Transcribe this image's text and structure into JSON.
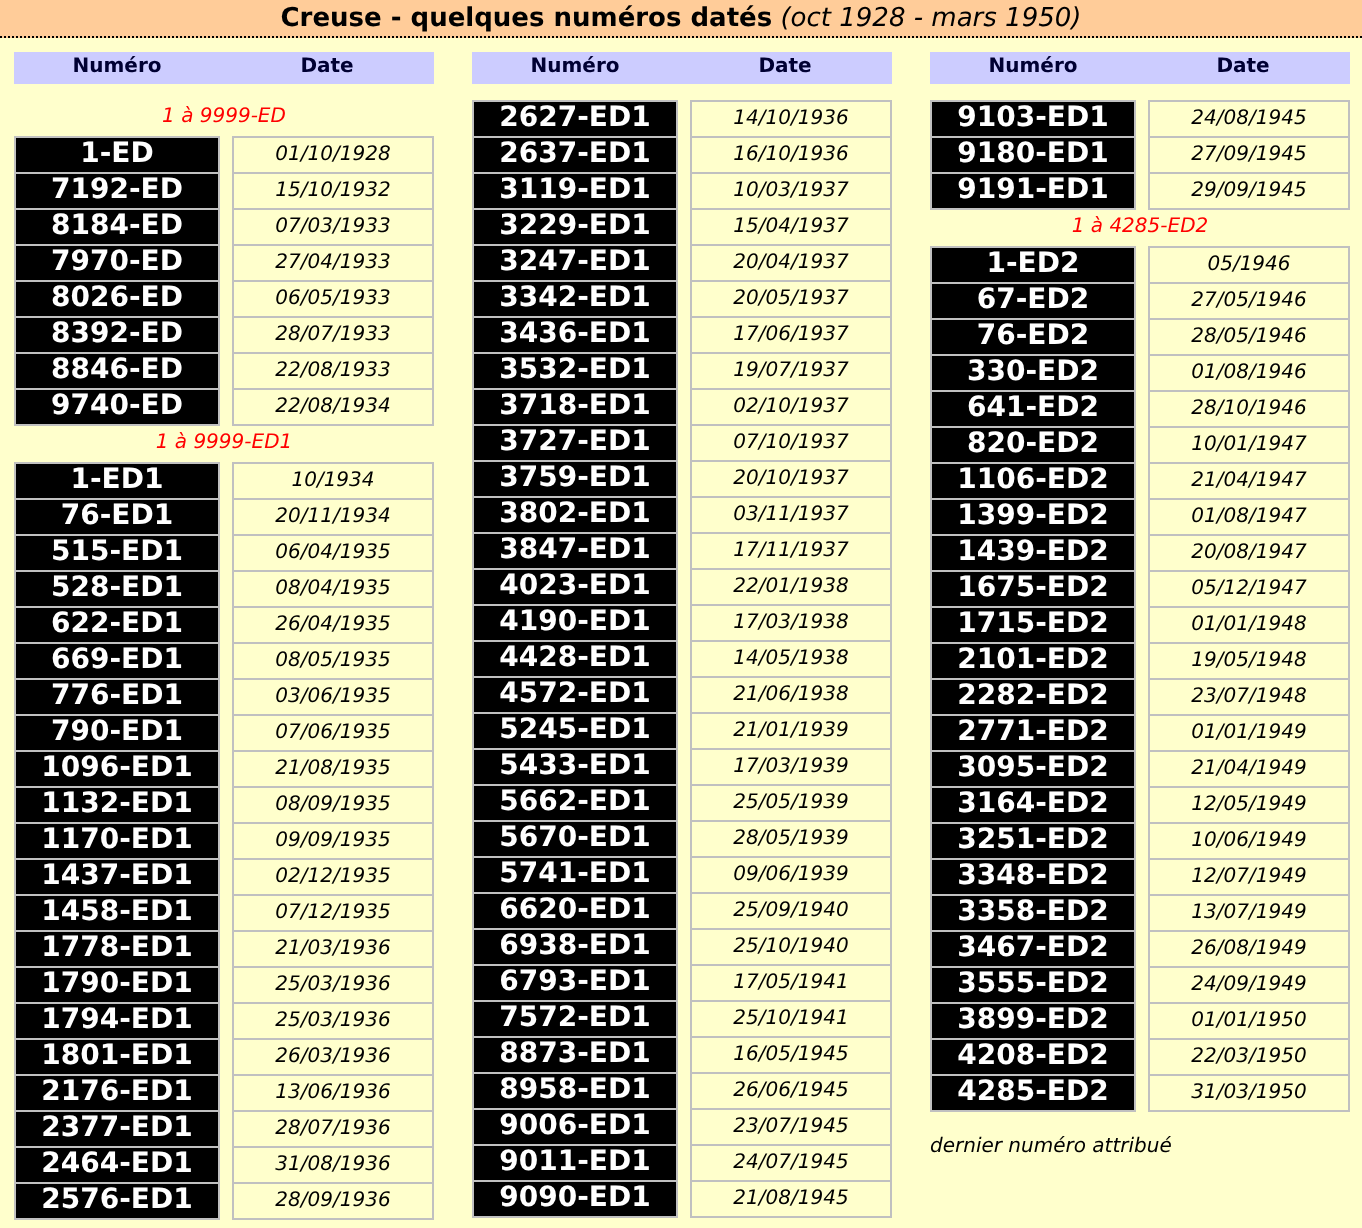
{
  "title": "**Creuse - quelques numéros datés** *(oct 1928 - mars 1950)*",
  "columns": [
    {
      "headers": [
        "Numéro",
        "Date"
      ],
      "blocks": [
        {
          "kind": "range",
          "text": "1 à 9999-ED"
        },
        {
          "kind": "group",
          "rows": [
            {
              "plate": "1-ED",
              "date": "01/10/1928"
            },
            {
              "plate": "7192-ED",
              "date": "15/10/1932"
            },
            {
              "plate": "8184-ED",
              "date": "07/03/1933"
            },
            {
              "plate": "7970-ED",
              "date": "27/04/1933"
            },
            {
              "plate": "8026-ED",
              "date": "06/05/1933"
            },
            {
              "plate": "8392-ED",
              "date": "28/07/1933"
            },
            {
              "plate": "8846-ED",
              "date": "22/08/1933"
            },
            {
              "plate": "9740-ED",
              "date": "22/08/1934"
            }
          ]
        },
        {
          "kind": "range",
          "text": "1 à 9999-ED1"
        },
        {
          "kind": "group",
          "rows": [
            {
              "plate": "1-ED1",
              "date": "10/1934"
            },
            {
              "plate": "76-ED1",
              "date": "20/11/1934"
            },
            {
              "plate": "515-ED1",
              "date": "06/04/1935"
            },
            {
              "plate": "528-ED1",
              "date": "08/04/1935"
            },
            {
              "plate": "622-ED1",
              "date": "26/04/1935"
            },
            {
              "plate": "669-ED1",
              "date": "08/05/1935"
            },
            {
              "plate": "776-ED1",
              "date": "03/06/1935"
            },
            {
              "plate": "790-ED1",
              "date": "07/06/1935"
            },
            {
              "plate": "1096-ED1",
              "date": "21/08/1935"
            },
            {
              "plate": "1132-ED1",
              "date": "08/09/1935"
            },
            {
              "plate": "1170-ED1",
              "date": "09/09/1935"
            },
            {
              "plate": "1437-ED1",
              "date": "02/12/1935"
            },
            {
              "plate": "1458-ED1",
              "date": "07/12/1935"
            },
            {
              "plate": "1778-ED1",
              "date": "21/03/1936"
            },
            {
              "plate": "1790-ED1",
              "date": "25/03/1936"
            },
            {
              "plate": "1794-ED1",
              "date": "25/03/1936"
            },
            {
              "plate": "1801-ED1",
              "date": "26/03/1936"
            },
            {
              "plate": "2176-ED1",
              "date": "13/06/1936"
            },
            {
              "plate": "2377-ED1",
              "date": "28/07/1936"
            },
            {
              "plate": "2464-ED1",
              "date": "31/08/1936"
            },
            {
              "plate": "2576-ED1",
              "date": "28/09/1936"
            }
          ]
        }
      ]
    },
    {
      "headers": [
        "Numéro",
        "Date"
      ],
      "blocks": [
        {
          "kind": "group",
          "rows": [
            {
              "plate": "2627-ED1",
              "date": "14/10/1936"
            },
            {
              "plate": "2637-ED1",
              "date": "16/10/1936"
            },
            {
              "plate": "3119-ED1",
              "date": "10/03/1937"
            },
            {
              "plate": "3229-ED1",
              "date": "15/04/1937"
            },
            {
              "plate": "3247-ED1",
              "date": "20/04/1937"
            },
            {
              "plate": "3342-ED1",
              "date": "20/05/1937"
            },
            {
              "plate": "3436-ED1",
              "date": "17/06/1937"
            },
            {
              "plate": "3532-ED1",
              "date": "19/07/1937"
            },
            {
              "plate": "3718-ED1",
              "date": "02/10/1937"
            },
            {
              "plate": "3727-ED1",
              "date": "07/10/1937"
            },
            {
              "plate": "3759-ED1",
              "date": "20/10/1937"
            },
            {
              "plate": "3802-ED1",
              "date": "03/11/1937"
            },
            {
              "plate": "3847-ED1",
              "date": "17/11/1937"
            },
            {
              "plate": "4023-ED1",
              "date": "22/01/1938"
            },
            {
              "plate": "4190-ED1",
              "date": "17/03/1938"
            },
            {
              "plate": "4428-ED1",
              "date": "14/05/1938"
            },
            {
              "plate": "4572-ED1",
              "date": "21/06/1938"
            },
            {
              "plate": "5245-ED1",
              "date": "21/01/1939"
            },
            {
              "plate": "5433-ED1",
              "date": "17/03/1939"
            },
            {
              "plate": "5662-ED1",
              "date": "25/05/1939"
            },
            {
              "plate": "5670-ED1",
              "date": "28/05/1939"
            },
            {
              "plate": "5741-ED1",
              "date": "09/06/1939"
            },
            {
              "plate": "6620-ED1",
              "date": "25/09/1940"
            },
            {
              "plate": "6938-ED1",
              "date": "25/10/1940"
            },
            {
              "plate": "6793-ED1",
              "date": "17/05/1941"
            },
            {
              "plate": "7572-ED1",
              "date": "25/10/1941"
            },
            {
              "plate": "8873-ED1",
              "date": "16/05/1945"
            },
            {
              "plate": "8958-ED1",
              "date": "26/06/1945"
            },
            {
              "plate": "9006-ED1",
              "date": "23/07/1945"
            },
            {
              "plate": "9011-ED1",
              "date": "24/07/1945"
            },
            {
              "plate": "9090-ED1",
              "date": "21/08/1945"
            }
          ]
        }
      ]
    },
    {
      "headers": [
        "Numéro",
        "Date"
      ],
      "blocks": [
        {
          "kind": "group",
          "rows": [
            {
              "plate": "9103-ED1",
              "date": "24/08/1945"
            },
            {
              "plate": "9180-ED1",
              "date": "27/09/1945"
            },
            {
              "plate": "9191-ED1",
              "date": "29/09/1945"
            }
          ]
        },
        {
          "kind": "range",
          "text": "1 à 4285-ED2"
        },
        {
          "kind": "group",
          "rows": [
            {
              "plate": "1-ED2",
              "date": "05/1946"
            },
            {
              "plate": "67-ED2",
              "date": "27/05/1946"
            },
            {
              "plate": "76-ED2",
              "date": "28/05/1946"
            },
            {
              "plate": "330-ED2",
              "date": "01/08/1946"
            },
            {
              "plate": "641-ED2",
              "date": "28/10/1946"
            },
            {
              "plate": "820-ED2",
              "date": "10/01/1947"
            },
            {
              "plate": "1106-ED2",
              "date": "21/04/1947"
            },
            {
              "plate": "1399-ED2",
              "date": "01/08/1947"
            },
            {
              "plate": "1439-ED2",
              "date": "20/08/1947"
            },
            {
              "plate": "1675-ED2",
              "date": "05/12/1947"
            },
            {
              "plate": "1715-ED2",
              "date": "01/01/1948"
            },
            {
              "plate": "2101-ED2",
              "date": "19/05/1948"
            },
            {
              "plate": "2282-ED2",
              "date": "23/07/1948"
            },
            {
              "plate": "2771-ED2",
              "date": "01/01/1949"
            },
            {
              "plate": "3095-ED2",
              "date": "21/04/1949"
            },
            {
              "plate": "3164-ED2",
              "date": "12/05/1949"
            },
            {
              "plate": "3251-ED2",
              "date": "10/06/1949"
            },
            {
              "plate": "3348-ED2",
              "date": "12/07/1949"
            },
            {
              "plate": "3358-ED2",
              "date": "13/07/1949"
            },
            {
              "plate": "3467-ED2",
              "date": "26/08/1949"
            },
            {
              "plate": "3555-ED2",
              "date": "24/09/1949"
            },
            {
              "plate": "3899-ED2",
              "date": "01/01/1950"
            },
            {
              "plate": "4208-ED2",
              "date": "22/03/1950"
            },
            {
              "plate": "4285-ED2",
              "date": "31/03/1950"
            }
          ]
        },
        {
          "kind": "note",
          "text": "dernier numéro attribué"
        }
      ]
    }
  ]
}
